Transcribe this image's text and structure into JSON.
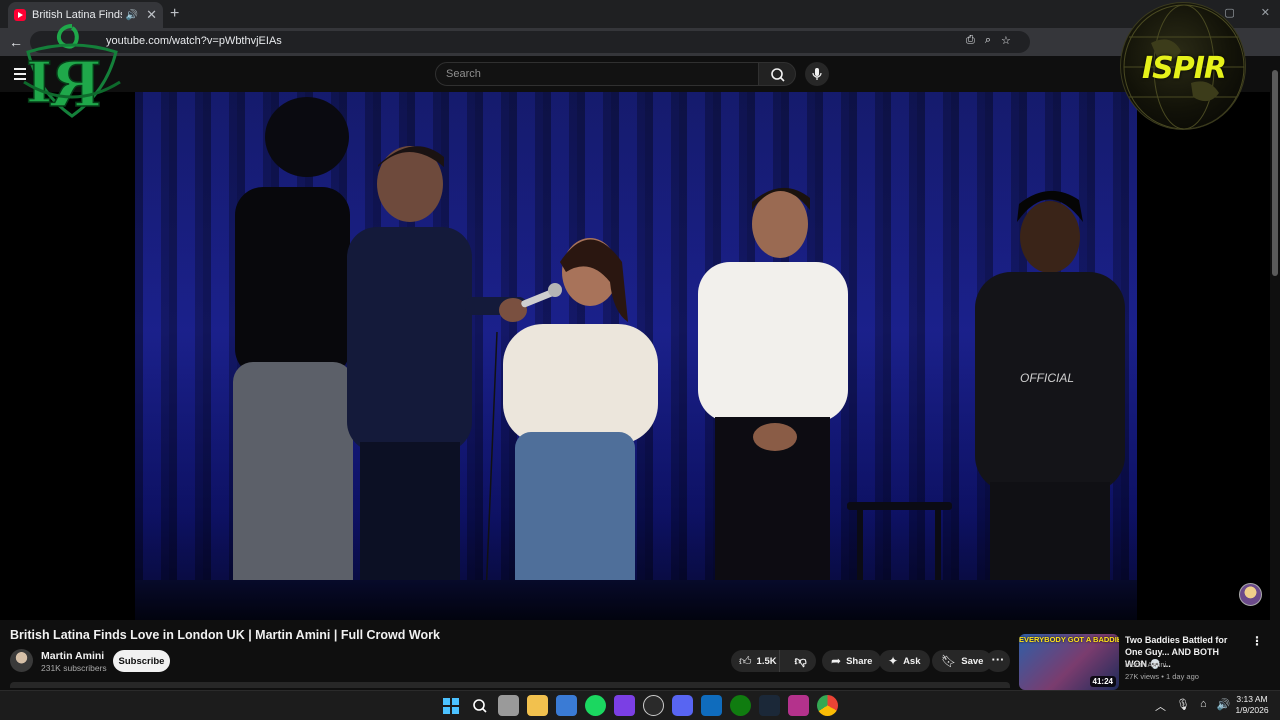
{
  "browser": {
    "tab_title": "British Latina Finds Love in London UK | Martin Amini | Full Crowd Work",
    "url": "youtube.com/watch?v=pWbthvjEIAs",
    "new_tab": "+",
    "close_tab": "✕",
    "back": "←",
    "window_controls": [
      "—",
      "▢",
      "✕"
    ],
    "omnibox_icons": [
      "⎙",
      "⌕",
      "☆"
    ]
  },
  "youtube": {
    "search_placeholder": "Search",
    "video": {
      "title": "British Latina Finds Love in London UK | Martin Amini | Full Crowd Work",
      "channel": "Martin Amini",
      "subscribers": "231K subscribers",
      "subscribe_label": "Subscribe",
      "likes": "1.5K",
      "share_label": "Share",
      "ask_label": "Ask",
      "save_label": "Save",
      "more_label": "···"
    },
    "recommended": {
      "title": "Two Baddies Battled for One Guy... AND BOTH WON 💀 ...",
      "channel": "Martin Amini",
      "meta": "27K views • 1 day ago",
      "duration": "41:24",
      "thumb_text": "EVERYBODY GOT A BADDIE"
    }
  },
  "overlays": {
    "logo_text": "ISPIR"
  },
  "taskbar": {
    "time": "3:13 AM",
    "date": "1/9/2026",
    "tray": [
      "︿",
      "🎙",
      "⌂",
      "🔊"
    ]
  },
  "colors": {
    "youtube_red": "#ff0033",
    "background": "#0f0f0f",
    "stage_blue": "#1a208a",
    "logo_yellow": "#e6f21a",
    "ir_green": "#1fa84a"
  }
}
